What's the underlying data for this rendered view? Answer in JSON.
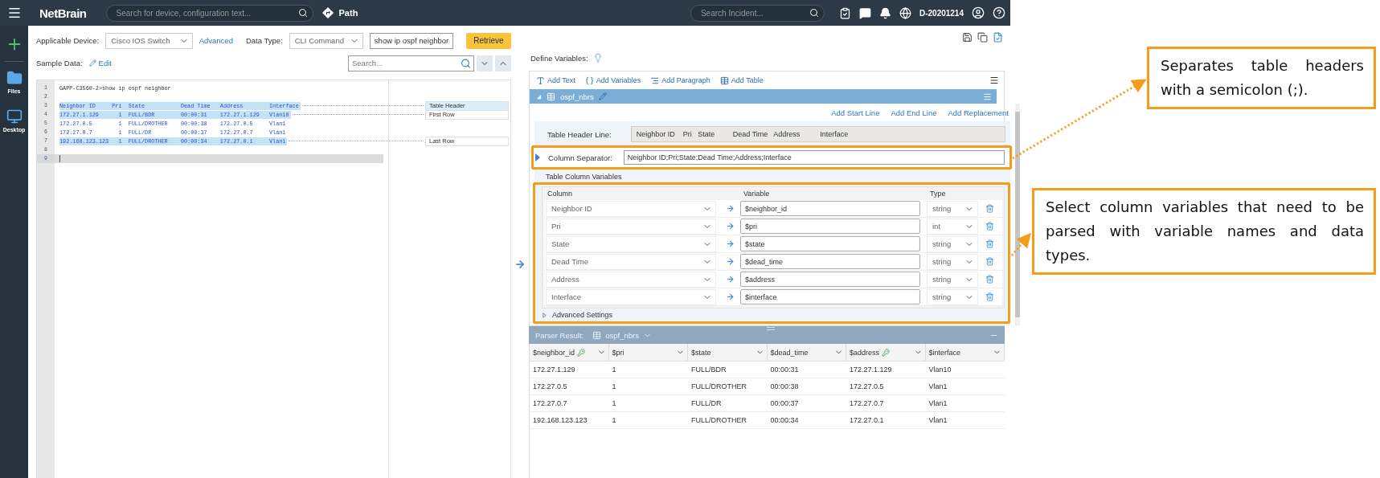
{
  "top_bar": {
    "logo": "NetBrain",
    "search_placeholder": "Search for device, configuration text...",
    "path_button": "Path",
    "incident_placeholder": "Search Incident...",
    "domain": "D-20201214"
  },
  "left_rail": {
    "items": [
      {
        "label": "Files",
        "kind": "files"
      },
      {
        "label": "Desktop",
        "kind": "desktop"
      }
    ]
  },
  "device_form": {
    "device_label": "Applicable Device:",
    "device": "Cisco IOS Switch",
    "advanced_link": "Advanced",
    "data_type_label": "Data Type:",
    "data_type": "CLI Command",
    "command": "show ip ospf neighbor",
    "retrieve_button": "Retrieve"
  },
  "sample_data": {
    "label": "Sample Data:",
    "edit_link": "Edit",
    "search_placeholder": "Search..."
  },
  "editor": {
    "lines": [
      {
        "number": "1",
        "text": "GAPP-C3560-2>show ip ospf neighbor",
        "in_table": false,
        "highlighted": false,
        "current": false
      },
      {
        "number": "2",
        "current": false
      },
      {
        "number": "3",
        "text": "Neighbor ID     Pri  State           Dead Time   Address        Interface",
        "in_table": true,
        "highlighted": true,
        "current": false,
        "region_label": {
          "text": "Table Header",
          "selected": true
        }
      },
      {
        "number": "4",
        "text": "172.27.1.129      1  FULL/BDR        00:00:31    172.27.1.129   Vlan10",
        "in_table": true,
        "highlighted": true,
        "current": false,
        "region_label": {
          "text": "First Row",
          "selected": false
        }
      },
      {
        "number": "5",
        "text": "172.27.0.5        1  FULL/DROTHER    00:00:38    172.27.0.5     Vlan1",
        "in_table": true,
        "highlighted": false,
        "current": false
      },
      {
        "number": "6",
        "text": "172.27.0.7        1  FULL/DR         00:00:37    172.27.0.7     Vlan1",
        "in_table": true,
        "highlighted": false,
        "current": false
      },
      {
        "number": "7",
        "text": "192.168.123.123   1  FULL/DROTHER    00:00:34    172.27.0.1     Vlan1",
        "in_table": true,
        "highlighted": true,
        "current": false,
        "region_label": {
          "text": "Last Row",
          "selected": false
        }
      },
      {
        "number": "8",
        "current": false
      },
      {
        "number": "9",
        "current": true
      }
    ]
  },
  "define_variables": {
    "label": "Define Variables:",
    "toolbar": [
      "Add Text",
      "Add Variables",
      "Add Paragraph",
      "Add Table"
    ]
  },
  "table_section": {
    "name": "ospf_nbrs",
    "expanded": true,
    "links": [
      "Add Start Line",
      "Add End Line",
      "Add Replacement"
    ],
    "header_line_label": "Table Header Line:",
    "header_line": "Neighbor ID    Pri   State         Dead Time   Address          Interface",
    "separator_label": "Column Separator:",
    "separator": "Neighbor ID;Pri;State;Dead Time;Address;Interface",
    "variables_label": "Table Column Variables",
    "variable_headers": [
      "Column",
      "Variable",
      "Type"
    ],
    "variables": [
      {
        "column": "Neighbor ID",
        "variable": "$neighbor_id",
        "type": "string"
      },
      {
        "column": "Pri",
        "variable": "$pri",
        "type": "int"
      },
      {
        "column": "State",
        "variable": "$state",
        "type": "string"
      },
      {
        "column": "Dead Time",
        "variable": "$dead_time",
        "type": "string"
      },
      {
        "column": "Address",
        "variable": "$address",
        "type": "string"
      },
      {
        "column": "Interface",
        "variable": "$interface",
        "type": "string"
      }
    ],
    "advanced": {
      "label": "Advanced Settings",
      "expanded": false
    }
  },
  "parser_result": {
    "label": "Parser Result:",
    "table": "ospf_nbrs",
    "columns": [
      {
        "label": "$neighbor_id",
        "key": true
      },
      {
        "label": "$pri",
        "key": false
      },
      {
        "label": "$state",
        "key": false
      },
      {
        "label": "$dead_time",
        "key": false
      },
      {
        "label": "$address",
        "key": true
      },
      {
        "label": "$interface",
        "key": false
      }
    ],
    "rows": [
      [
        "172.27.1.129",
        "1",
        "FULL/BDR",
        "00:00:31",
        "172.27.1.129",
        "Vlan10"
      ],
      [
        "172.27.0.5",
        "1",
        "FULL/DROTHER",
        "00:00:38",
        "172.27.0.5",
        "Vlan1"
      ],
      [
        "172.27.0.7",
        "1",
        "FULL/DR",
        "00:00:37",
        "172.27.0.7",
        "Vlan1"
      ],
      [
        "192.168.123.123",
        "1",
        "FULL/DROTHER",
        "00:00:34",
        "172.27.0.1",
        "Vlan1"
      ]
    ]
  },
  "callouts": [
    {
      "text": "Separates table headers with a semicolon (;)."
    },
    {
      "text": "Select column variables that need to be parsed with variable names and data types."
    }
  ]
}
